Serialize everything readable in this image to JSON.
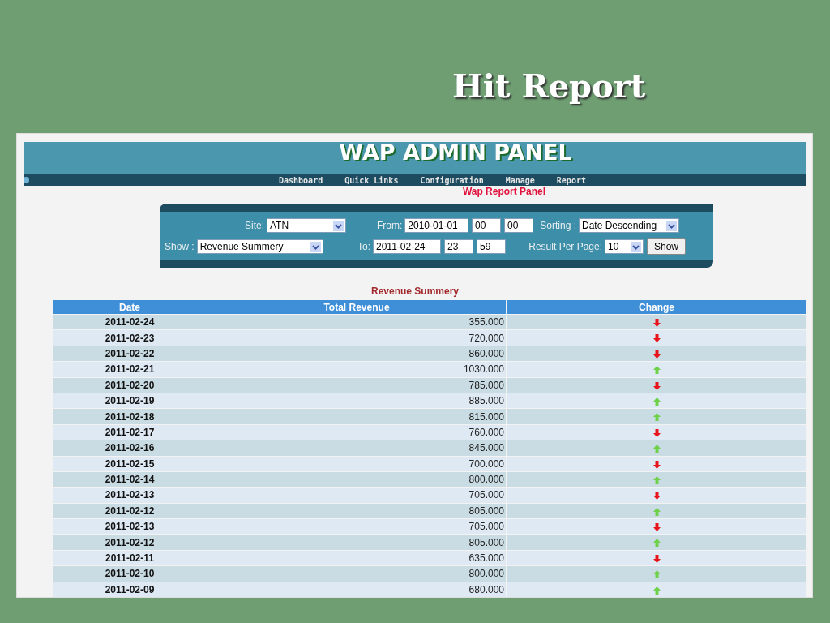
{
  "slide_title": "Hit Report",
  "app": {
    "title": "WAP ADMIN PANEL",
    "nav": [
      "Dashboard",
      "Quick Links",
      "Configuration",
      "Manage",
      "Report"
    ],
    "panel_title": "Wap Report Panel",
    "filters": [
      [
        {
          "kind": "select",
          "label": "Site:",
          "value": "ATN"
        },
        {
          "kind": "input",
          "label": "From:",
          "value": "2010-01-01"
        },
        {
          "kind": "input",
          "value": "00"
        },
        {
          "kind": "input",
          "value": "00"
        },
        {
          "kind": "select",
          "label": "Sorting :",
          "value": "Date Descending"
        }
      ],
      [
        {
          "kind": "select",
          "label": "Show :",
          "value": "Revenue Summery"
        },
        {
          "kind": "input",
          "label": "To:",
          "value": "2011-02-24"
        },
        {
          "kind": "input",
          "value": "23"
        },
        {
          "kind": "input",
          "value": "59"
        },
        {
          "kind": "select",
          "label": "Result Per Page:",
          "value": "10"
        },
        {
          "kind": "button",
          "value": "Show"
        }
      ]
    ],
    "table": {
      "title": "Revenue Summery",
      "columns": [
        "Date",
        "Total Revenue",
        "Change"
      ],
      "rows": [
        {
          "date": "2011-02-24",
          "revenue": "355.000",
          "increased": false
        },
        {
          "date": "2011-02-23",
          "revenue": "720.000",
          "increased": false
        },
        {
          "date": "2011-02-22",
          "revenue": "860.000",
          "increased": false
        },
        {
          "date": "2011-02-21",
          "revenue": "1030.000",
          "increased": true
        },
        {
          "date": "2011-02-20",
          "revenue": "785.000",
          "increased": false
        },
        {
          "date": "2011-02-19",
          "revenue": "885.000",
          "increased": true
        },
        {
          "date": "2011-02-18",
          "revenue": "815.000",
          "increased": true
        },
        {
          "date": "2011-02-17",
          "revenue": "760.000",
          "increased": false
        },
        {
          "date": "2011-02-16",
          "revenue": "845.000",
          "increased": true
        },
        {
          "date": "2011-02-15",
          "revenue": "700.000",
          "increased": false
        },
        {
          "date": "2011-02-14",
          "revenue": "800.000",
          "increased": true
        },
        {
          "date": "2011-02-13",
          "revenue": "705.000",
          "increased": false
        },
        {
          "date": "2011-02-12",
          "revenue": "805.000",
          "increased": true
        },
        {
          "date": "2011-02-13",
          "revenue": "705.000",
          "increased": false
        },
        {
          "date": "2011-02-12",
          "revenue": "805.000",
          "increased": true
        },
        {
          "date": "2011-02-11",
          "revenue": "635.000",
          "increased": false
        },
        {
          "date": "2011-02-10",
          "revenue": "800.000",
          "increased": true
        },
        {
          "date": "2011-02-09",
          "revenue": "680.000",
          "increased": true
        }
      ]
    }
  }
}
